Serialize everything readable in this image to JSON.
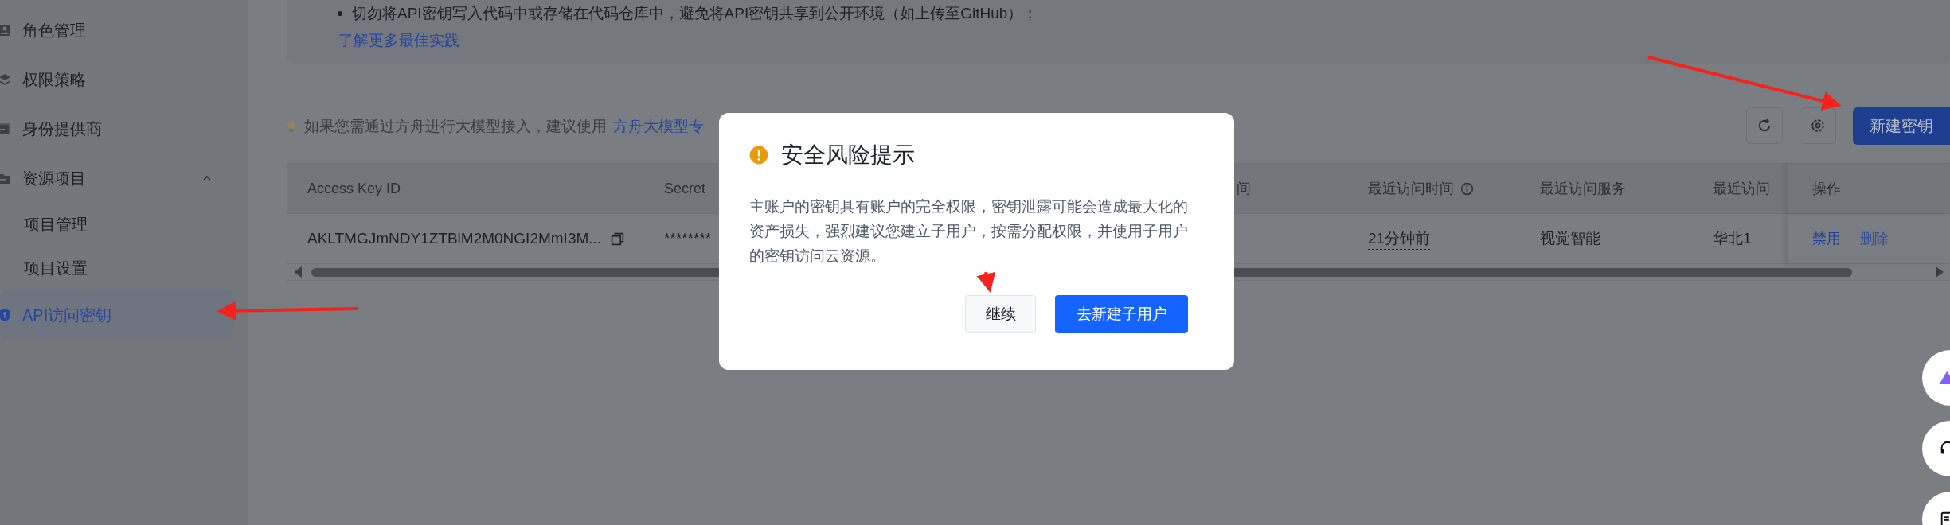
{
  "sidebar": {
    "items": [
      {
        "label": "角色管理",
        "selected": false
      },
      {
        "label": "权限策略",
        "selected": false
      },
      {
        "label": "身份提供商",
        "selected": false
      },
      {
        "label": "资源项目",
        "selected": false,
        "expanded": true,
        "children": [
          {
            "label": "项目管理",
            "selected": false
          },
          {
            "label": "项目设置",
            "selected": false
          }
        ]
      },
      {
        "label": "API访问密钥",
        "selected": true
      }
    ]
  },
  "notice": {
    "bullets": [
      "切勿将API密钥写入代码中或存储在代码仓库中，避免将API密钥共享到公开环境（如上传至GitHub）；"
    ],
    "link": "了解更多最佳实践"
  },
  "hint": {
    "text": "如果您需通过方舟进行大模型接入，建议使用",
    "link": "方舟大模型专"
  },
  "toolbar": {
    "buttons": [
      {
        "kind": "refresh"
      },
      {
        "kind": "settings"
      },
      {
        "kind": "primary",
        "label": "新建密钥"
      }
    ]
  },
  "table": {
    "columns": [
      {
        "header": "Access Key ID",
        "cell": "AKLTMGJmNDY1ZTBlM2M0NGI2MmI3M...",
        "copyable": true
      },
      {
        "header": "Secret",
        "cell": "********"
      },
      {
        "header": "间"
      },
      {
        "header": "最近访问时间",
        "info": true,
        "cell": "21分钟前",
        "tooltip": true
      },
      {
        "header": "最近访问服务",
        "cell": "视觉智能"
      },
      {
        "header": "最近访问",
        "cell": "华北1"
      }
    ],
    "actions_header": "操作",
    "actions": [
      {
        "label": "禁用",
        "disabled": false
      },
      {
        "label": "删除",
        "disabled": true
      }
    ]
  },
  "dialog": {
    "title": "安全风险提示",
    "body": "主账户的密钥具有账户的完全权限，密钥泄露可能会造成最大化的资产损失，强烈建议您建立子用户，按需分配权限，并使用子用户的密钥访问云资源。",
    "buttons": [
      {
        "label": "继续",
        "kind": "secondary"
      },
      {
        "label": "去新建子用户",
        "kind": "primary"
      }
    ]
  },
  "floating_buttons": [
    {
      "kind": "logo"
    },
    {
      "kind": "headset"
    },
    {
      "kind": "document"
    }
  ]
}
